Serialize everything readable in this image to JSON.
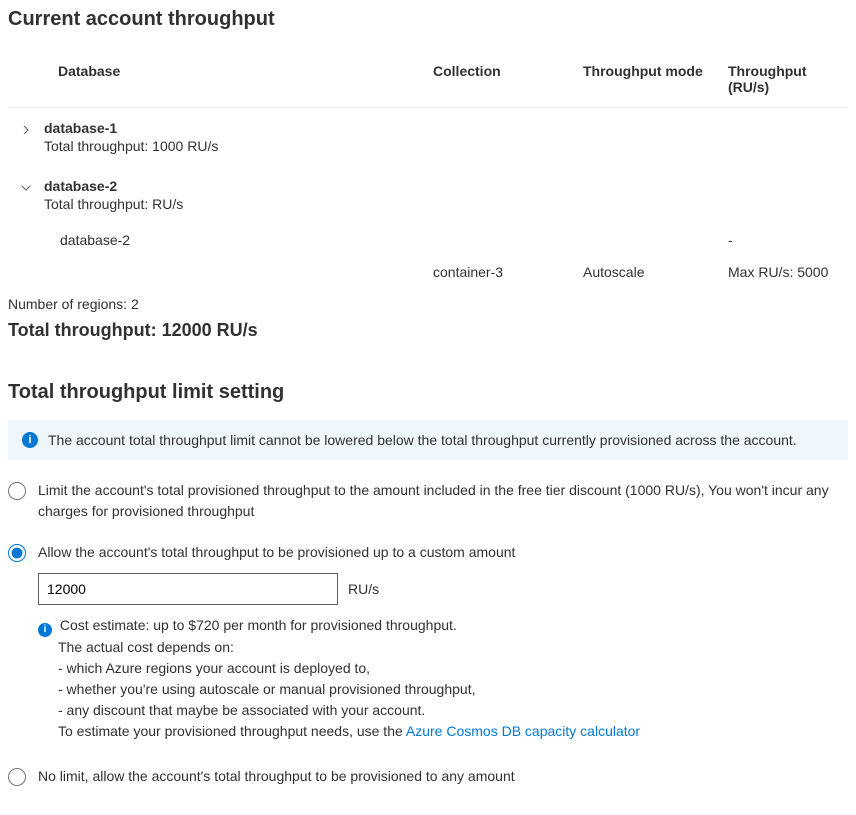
{
  "section1": {
    "title": "Current account throughput",
    "columns": {
      "database": "Database",
      "collection": "Collection",
      "mode": "Throughput mode",
      "throughput": "Throughput (RU/s)"
    },
    "db1": {
      "name": "database-1",
      "sub": "Total throughput: 1000 RU/s"
    },
    "db2": {
      "name": "database-2",
      "sub": "Total throughput: RU/s",
      "row1_c1": "database-2",
      "row1_c4": "-",
      "row2_c2": "container-3",
      "row2_c3": "Autoscale",
      "row2_c4": "Max RU/s: 5000"
    },
    "regions": "Number of regions: 2",
    "total": "Total throughput: 12000 RU/s"
  },
  "section2": {
    "title": "Total throughput limit setting",
    "banner": "The account total throughput limit cannot be lowered below the total throughput currently provisioned across the account.",
    "opt1": "Limit the account's total provisioned throughput to the amount included in the free tier discount (1000 RU/s), You won't incur any charges for provisioned throughput",
    "opt2": "Allow the account's total throughput to be provisioned up to a custom amount",
    "amount": "12000",
    "unit": "RU/s",
    "cost_l1": "Cost estimate: up to $720 per month for provisioned throughput.",
    "cost_l2": "The actual cost depends on:",
    "cost_l3": "- which Azure regions your account is deployed to,",
    "cost_l4": "- whether you're using autoscale or manual provisioned throughput,",
    "cost_l5": "- any discount that maybe be associated with your account.",
    "cost_l6": "To estimate your provisioned throughput needs, use the ",
    "calc_link": "Azure Cosmos DB capacity calculator",
    "opt3": "No limit, allow the account's total throughput to be provisioned to any amount"
  }
}
